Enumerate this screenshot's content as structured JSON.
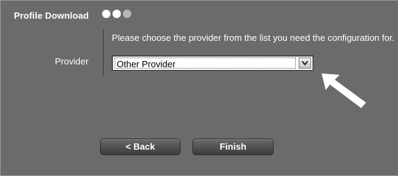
{
  "header": {
    "title": "Profile Download",
    "steps": [
      {
        "state": "complete"
      },
      {
        "state": "current"
      },
      {
        "state": "pending"
      }
    ]
  },
  "main": {
    "instruction": "Please choose the provider from the list you need the configuration for.",
    "provider_field": {
      "label": "Provider",
      "selected_value": "Other Provider"
    }
  },
  "footer": {
    "back_label": "< Back",
    "finish_label": "Finish"
  },
  "icons": {
    "dropdown": "chevron-down-icon",
    "annotation": "arrow-pointer-icon"
  },
  "colors": {
    "background": "#6b6b6b",
    "text": "#ffffff",
    "button": "#4a4a4a"
  }
}
